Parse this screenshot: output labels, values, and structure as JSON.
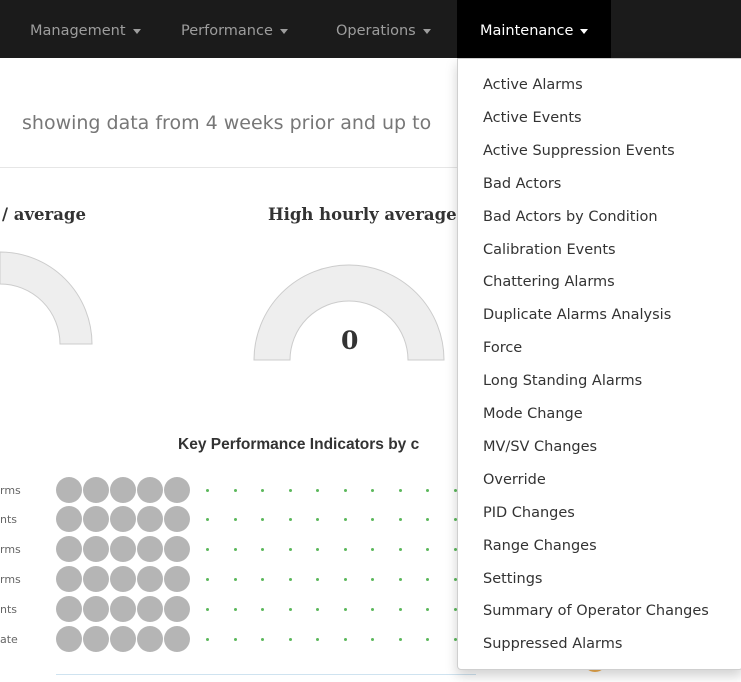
{
  "navbar": {
    "items": [
      {
        "label": "Management"
      },
      {
        "label": "Performance"
      },
      {
        "label": "Operations"
      },
      {
        "label": "Maintenance"
      }
    ]
  },
  "main": {
    "subtitle": "showing data from 4 weeks prior and up to",
    "gauges": [
      {
        "title": "/ average"
      },
      {
        "title": "High hourly average",
        "value": "0"
      }
    ],
    "kpi_title": "Key Performance Indicators by c",
    "kpi_rows": [
      "rms",
      "nts",
      "rms",
      "rms",
      "nts",
      "ate"
    ]
  },
  "maintenance_menu": {
    "items": [
      "Active Alarms",
      "Active Events",
      "Active Suppression Events",
      "Bad Actors",
      "Bad Actors by Condition",
      "Calibration Events",
      "Chattering Alarms",
      "Duplicate Alarms Analysis",
      "Force",
      "Long Standing Alarms",
      "Mode Change",
      "MV/SV Changes",
      "Override",
      "PID Changes",
      "Range Changes",
      "Settings",
      "Summary of Operator Changes",
      "Suppressed Alarms"
    ]
  }
}
